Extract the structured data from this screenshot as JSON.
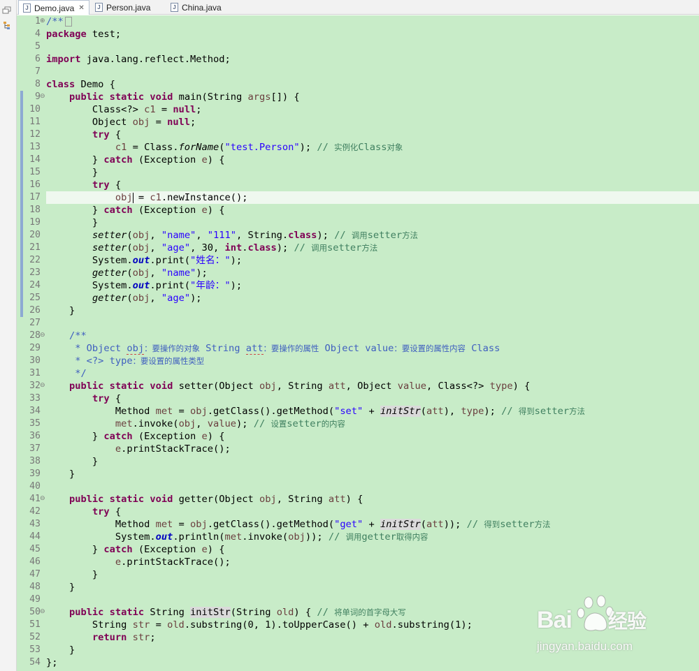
{
  "tabs": [
    {
      "label": "Demo.java",
      "active": true,
      "icon": "java-file-icon",
      "closable": true
    },
    {
      "label": "Person.java",
      "active": false,
      "icon": "java-file-icon"
    },
    {
      "label": "China.java",
      "active": false,
      "icon": "java-file-icon"
    }
  ],
  "tab_close_glyph": "✕",
  "file_icon_glyph": "J",
  "sidebar_icons": [
    "restore-icon",
    "hierarchy-icon"
  ],
  "editor": {
    "background_color": "#c8ecc8",
    "current_line": 17,
    "lines": [
      {
        "n": "1",
        "fold": "plus",
        "html": "<span class=\"jd\">/**</span><span class=\"collapsed-box\"></span>"
      },
      {
        "n": "4",
        "html": "<span class=\"kw\">package</span> test;"
      },
      {
        "n": "5",
        "html": ""
      },
      {
        "n": "6",
        "html": "<span class=\"kw\">import</span> java.lang.reflect.Method;"
      },
      {
        "n": "7",
        "html": ""
      },
      {
        "n": "8",
        "html": "<span class=\"kw\">class</span> Demo {"
      },
      {
        "n": "9",
        "fold": "minus",
        "html": "    <span class=\"kw\">public</span> <span class=\"kw\">static</span> <span class=\"kw\">void</span> main(String <span class=\"var\">args</span>[]) {"
      },
      {
        "n": "10",
        "html": "        Class&lt;?&gt; <span class=\"var\">c1</span> = <span class=\"kw\">null</span>;"
      },
      {
        "n": "11",
        "html": "        Object <span class=\"var\">obj</span> = <span class=\"kw\">null</span>;"
      },
      {
        "n": "12",
        "html": "        <span class=\"kw\">try</span> {"
      },
      {
        "n": "13",
        "html": "            <span class=\"var\">c1</span> = Class.<span class=\"it\">forName</span>(<span class=\"str\">\"test.Person\"</span>); <span class=\"cmt\">// <span class=\"cjk\">实例化</span>Class<span class=\"cjk\">对象</span></span>"
      },
      {
        "n": "14",
        "html": "        } <span class=\"kw\">catch</span> (Exception <span class=\"var\">e</span>) {"
      },
      {
        "n": "15",
        "html": "        }"
      },
      {
        "n": "16",
        "html": "        <span class=\"kw\">try</span> {"
      },
      {
        "n": "17",
        "html": "            <span class=\"var\">obj</span><span class=\"caret\"></span> = <span class=\"var\">c1</span>.newInstance();"
      },
      {
        "n": "18",
        "html": "        } <span class=\"kw\">catch</span> (Exception <span class=\"var\">e</span>) {"
      },
      {
        "n": "19",
        "html": "        }"
      },
      {
        "n": "20",
        "html": "        <span class=\"it\">setter</span>(<span class=\"var\">obj</span>, <span class=\"str\">\"name\"</span>, <span class=\"str\">\"111\"</span>, String.<span class=\"kw\">class</span>); <span class=\"cmt\">// <span class=\"cjk\">调用</span>setter<span class=\"cjk\">方法</span></span>"
      },
      {
        "n": "21",
        "html": "        <span class=\"it\">setter</span>(<span class=\"var\">obj</span>, <span class=\"str\">\"age\"</span>, 30, <span class=\"kw\">int</span>.<span class=\"kw\">class</span>); <span class=\"cmt\">// <span class=\"cjk\">调用</span>setter<span class=\"cjk\">方法</span></span>"
      },
      {
        "n": "22",
        "html": "        System.<span class=\"fld\">out</span>.print(<span class=\"str\">\"<span class=\"cjk\">姓名：</span>\"</span>);"
      },
      {
        "n": "23",
        "html": "        <span class=\"it\">getter</span>(<span class=\"var\">obj</span>, <span class=\"str\">\"name\"</span>);"
      },
      {
        "n": "24",
        "html": "        System.<span class=\"fld\">out</span>.print(<span class=\"str\">\"<span class=\"cjk\">年龄：</span>\"</span>);"
      },
      {
        "n": "25",
        "html": "        <span class=\"it\">getter</span>(<span class=\"var\">obj</span>, <span class=\"str\">\"age\"</span>);"
      },
      {
        "n": "26",
        "html": "    }"
      },
      {
        "n": "27",
        "html": ""
      },
      {
        "n": "28",
        "fold": "minus",
        "html": "    <span class=\"jd\">/**</span>"
      },
      {
        "n": "29",
        "html": "<span class=\"jd\">     * Object <span class=\"dash\">obj</span><span class=\"cjk\">：要操作的对象</span> String <span class=\"dash\">att</span><span class=\"cjk\">：要操作的属性</span> Object value<span class=\"cjk\">：要设置的属性内容</span> Class</span>"
      },
      {
        "n": "30",
        "html": "<span class=\"jd\">     * &lt;?&gt; type<span class=\"cjk\">：要设置的属性类型</span></span>"
      },
      {
        "n": "31",
        "html": "<span class=\"jd\">     */</span>"
      },
      {
        "n": "32",
        "fold": "minus",
        "html": "    <span class=\"kw\">public</span> <span class=\"kw\">static</span> <span class=\"kw\">void</span> setter(Object <span class=\"var\">obj</span>, String <span class=\"var\">att</span>, Object <span class=\"var\">value</span>, Class&lt;?&gt; <span class=\"var\">type</span>) {"
      },
      {
        "n": "33",
        "html": "        <span class=\"kw\">try</span> {"
      },
      {
        "n": "34",
        "html": "            Method <span class=\"var\">met</span> = <span class=\"var\">obj</span>.getClass().getMethod(<span class=\"str\">\"set\"</span> + <span class=\"it mark\">initStr</span>(<span class=\"var\">att</span>), <span class=\"var\">type</span>); <span class=\"cmt\">// <span class=\"cjk\">得到</span>setter<span class=\"cjk\">方法</span></span>"
      },
      {
        "n": "35",
        "html": "            <span class=\"var\">met</span>.invoke(<span class=\"var\">obj</span>, <span class=\"var\">value</span>); <span class=\"cmt\">// <span class=\"cjk\">设置</span>setter<span class=\"cjk\">的内容</span></span>"
      },
      {
        "n": "36",
        "html": "        } <span class=\"kw\">catch</span> (Exception <span class=\"var\">e</span>) {"
      },
      {
        "n": "37",
        "html": "            <span class=\"var\">e</span>.printStackTrace();"
      },
      {
        "n": "38",
        "html": "        }"
      },
      {
        "n": "39",
        "html": "    }"
      },
      {
        "n": "40",
        "html": ""
      },
      {
        "n": "41",
        "fold": "minus",
        "html": "    <span class=\"kw\">public</span> <span class=\"kw\">static</span> <span class=\"kw\">void</span> getter(Object <span class=\"var\">obj</span>, String <span class=\"var\">att</span>) {"
      },
      {
        "n": "42",
        "html": "        <span class=\"kw\">try</span> {"
      },
      {
        "n": "43",
        "html": "            Method <span class=\"var\">met</span> = <span class=\"var\">obj</span>.getClass().getMethod(<span class=\"str\">\"get\"</span> + <span class=\"it mark\">initStr</span>(<span class=\"var\">att</span>)); <span class=\"cmt\">// <span class=\"cjk\">得到</span>setter<span class=\"cjk\">方法</span></span>"
      },
      {
        "n": "44",
        "html": "            System.<span class=\"fld\">out</span>.println(<span class=\"var\">met</span>.invoke(<span class=\"var\">obj</span>)); <span class=\"cmt\">// <span class=\"cjk\">调用</span>getter<span class=\"cjk\">取得内容</span></span>"
      },
      {
        "n": "45",
        "html": "        } <span class=\"kw\">catch</span> (Exception <span class=\"var\">e</span>) {"
      },
      {
        "n": "46",
        "html": "            <span class=\"var\">e</span>.printStackTrace();"
      },
      {
        "n": "47",
        "html": "        }"
      },
      {
        "n": "48",
        "html": "    }"
      },
      {
        "n": "49",
        "html": ""
      },
      {
        "n": "50",
        "fold": "minus",
        "html": "    <span class=\"kw\">public</span> <span class=\"kw\">static</span> String <span class=\"mark\">initStr</span>(String <span class=\"var\">old</span>) { <span class=\"cmt\">// <span class=\"cjk\">将单词的首字母大写</span></span>"
      },
      {
        "n": "51",
        "html": "        String <span class=\"var\">str</span> = <span class=\"var\">old</span>.substring(0, 1).toUpperCase() + <span class=\"var\">old</span>.substring(1);"
      },
      {
        "n": "52",
        "html": "        <span class=\"kw\">return</span> <span class=\"var\">str</span>;"
      },
      {
        "n": "53",
        "html": "    }"
      },
      {
        "n": "54",
        "html": "};"
      }
    ]
  },
  "watermark": {
    "brand_prefix": "Bai",
    "brand_suffix": "经验",
    "url": "jingyan.baidu.com"
  }
}
